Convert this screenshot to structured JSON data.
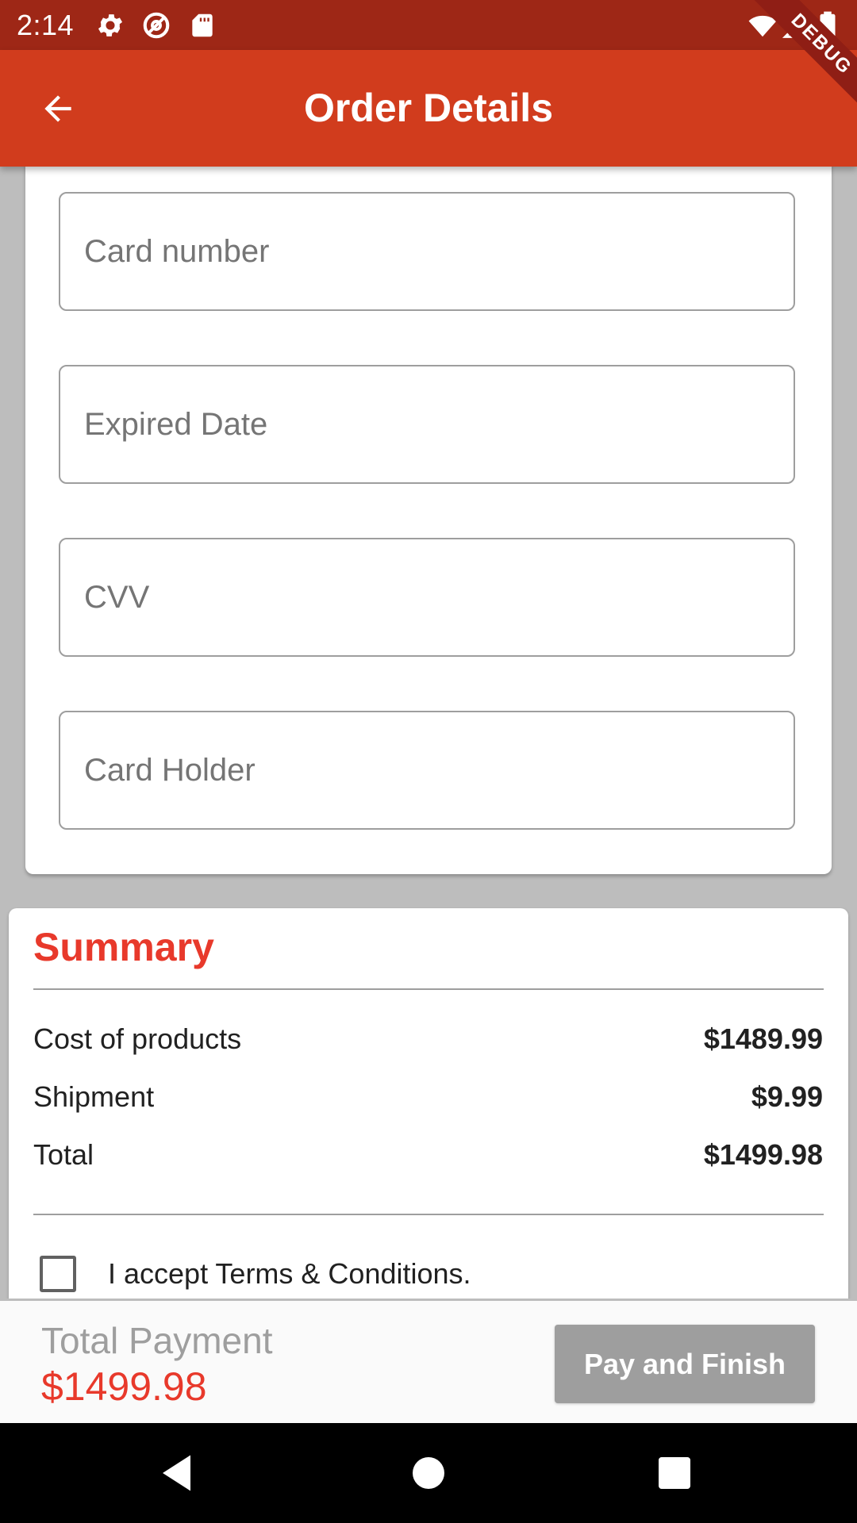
{
  "status_bar": {
    "time": "2:14",
    "icons": [
      "gear-icon",
      "at-icon",
      "sd-card-icon",
      "wifi-icon",
      "signal-icon",
      "battery-icon"
    ]
  },
  "app_bar": {
    "title": "Order Details",
    "color": "#d13c1d"
  },
  "debug_banner": "DEBUG",
  "payment_form": {
    "fields": [
      {
        "placeholder": "Card number"
      },
      {
        "placeholder": "Expired Date"
      },
      {
        "placeholder": "CVV"
      },
      {
        "placeholder": "Card Holder"
      }
    ]
  },
  "summary": {
    "title": "Summary",
    "rows": [
      {
        "label": "Cost of products",
        "value": "$1489.99"
      },
      {
        "label": "Shipment",
        "value": "$9.99"
      },
      {
        "label": "Total",
        "value": "$1499.98"
      }
    ],
    "terms_label": "I accept Terms & Conditions.",
    "terms_checked": false
  },
  "bottom_bar": {
    "total_label": "Total Payment",
    "total_value": "$1499.98",
    "pay_button_label": "Pay and Finish",
    "pay_button_enabled": false
  },
  "colors": {
    "accent": "#e8392b",
    "status_bar": "#9e2716",
    "disabled": "#9e9e9e"
  }
}
